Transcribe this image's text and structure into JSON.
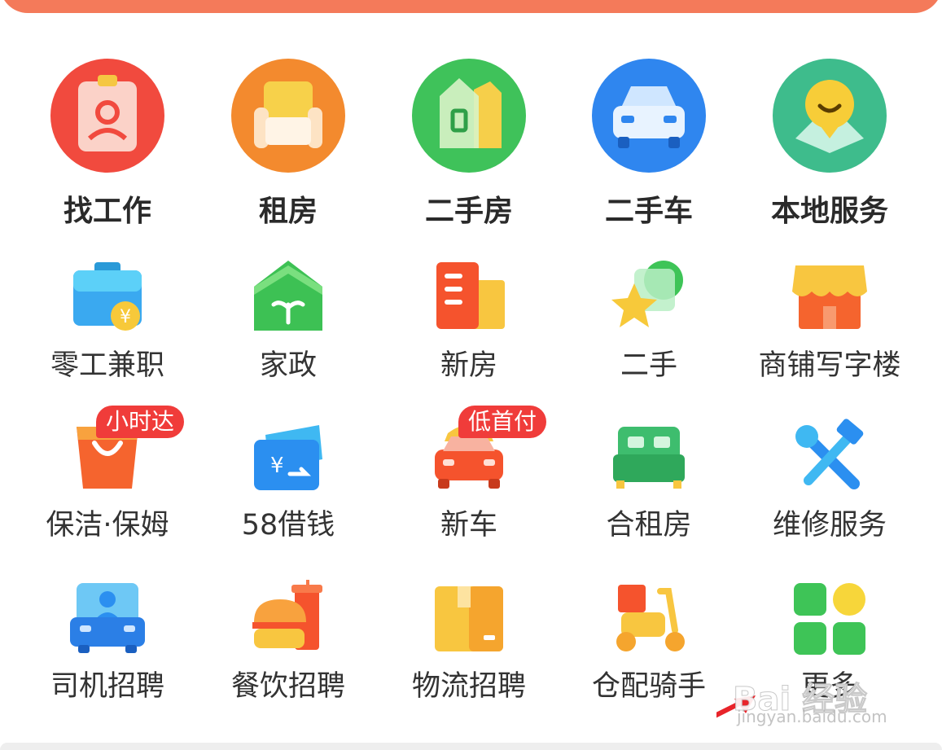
{
  "grid": {
    "items": [
      {
        "label": "找工作",
        "icon": "job-badge-icon"
      },
      {
        "label": "租房",
        "icon": "armchair-icon"
      },
      {
        "label": "二手房",
        "icon": "houses-icon"
      },
      {
        "label": "二手车",
        "icon": "car-icon"
      },
      {
        "label": "本地服务",
        "icon": "map-pin-smile-icon"
      },
      {
        "label": "零工兼职",
        "icon": "briefcase-yuan-icon"
      },
      {
        "label": "家政",
        "icon": "house-sprout-icon"
      },
      {
        "label": "新房",
        "icon": "building-icon"
      },
      {
        "label": "二手",
        "icon": "star-bubble-icon"
      },
      {
        "label": "商铺写字楼",
        "icon": "storefront-icon"
      },
      {
        "label": "保洁·保姆",
        "icon": "basket-icon",
        "badge": "小时达"
      },
      {
        "label": "58借钱",
        "icon": "yuan-card-icon"
      },
      {
        "label": "新车",
        "icon": "new-car-icon",
        "badge": "低首付"
      },
      {
        "label": "合租房",
        "icon": "bed-icon"
      },
      {
        "label": "维修服务",
        "icon": "wrench-hammer-icon"
      },
      {
        "label": "司机招聘",
        "icon": "bus-driver-icon"
      },
      {
        "label": "餐饮招聘",
        "icon": "burger-drink-icon"
      },
      {
        "label": "物流招聘",
        "icon": "package-icon"
      },
      {
        "label": "仓配骑手",
        "icon": "scooter-icon"
      },
      {
        "label": "更多",
        "icon": "grid-more-icon"
      }
    ]
  },
  "watermark": {
    "text": "Bai 经验",
    "url": "jingyan.baidu.com"
  },
  "colors": {
    "header": "#f47a5a",
    "badge": "#f03c3a",
    "arrow": "#e8242a"
  }
}
